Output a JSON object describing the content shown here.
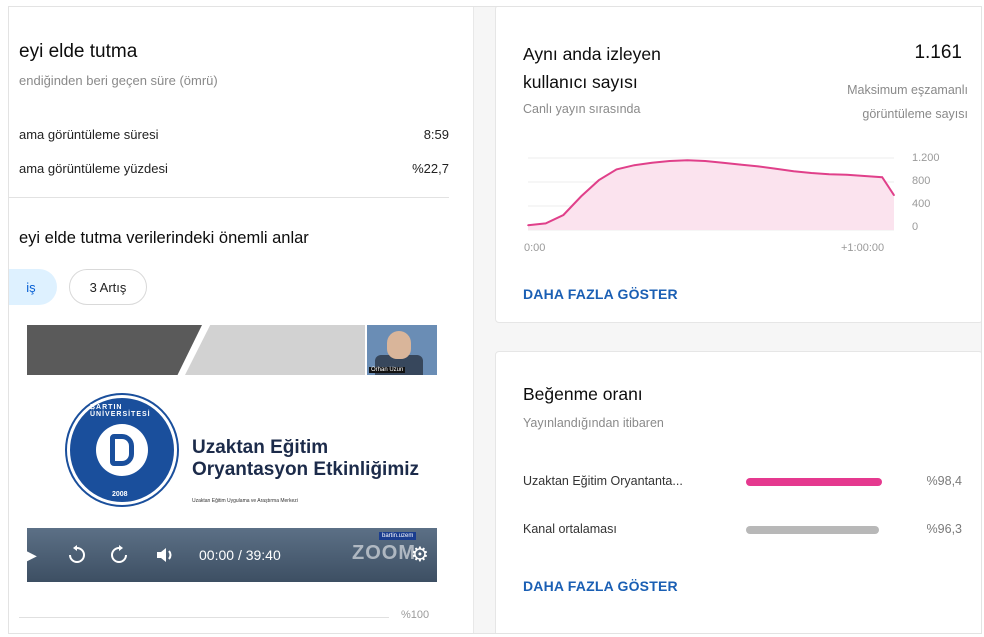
{
  "retention": {
    "title": "eyi elde tutma",
    "subtitle": "endiğinden beri geçen süre (ömrü)",
    "metrics": [
      {
        "label": "ama görüntüleme süresi",
        "value": "8:59"
      },
      {
        "label": "ama görüntüleme yüzdesi",
        "value": "%22,7"
      }
    ],
    "moments_title": "eyi elde tutma verilerindeki önemli anlar",
    "chips": [
      {
        "label": "iş",
        "active": true
      },
      {
        "label": "3 Artış",
        "active": false
      }
    ],
    "bottom_axis_label": "%100"
  },
  "video": {
    "slide_title_line1": "Uzaktan Eğitim",
    "slide_title_line2": "Oryantasyon Etkinliğimiz",
    "slide_small_text": "Uzaktan Eğitim Uygulama ve Araştırma Merkezi",
    "logo_ring_text": "BARTIN ÜNİVERSİTESİ",
    "logo_year": "2008",
    "cam_name": "Orhan Uzun",
    "time_current": "00:00",
    "time_total": "39:40",
    "watermark": "ZOOM",
    "badge_text": "bartin.uzem"
  },
  "concurrent": {
    "title_line1": "Aynı anda izleyen",
    "title_line2": "kullanıcı sayısı",
    "subtitle": "Canlı yayın sırasında",
    "value": "1.161",
    "value_sub_line1": "Maksimum eşzamanlı",
    "value_sub_line2": "görüntüleme sayısı",
    "more_label": "DAHA FAZLA GÖSTER"
  },
  "chart_data": {
    "type": "area",
    "x_tick_labels": [
      "0:00",
      "+1:00:00"
    ],
    "y_tick_labels": [
      "1.200",
      "800",
      "400",
      "0"
    ],
    "ylim": [
      0,
      1200
    ],
    "x_minutes": [
      0,
      3,
      6,
      9,
      12,
      15,
      18,
      21,
      24,
      27,
      30,
      33,
      36,
      39,
      42,
      45,
      48,
      51,
      54,
      57,
      60,
      62
    ],
    "values": [
      80,
      110,
      250,
      560,
      830,
      1010,
      1080,
      1120,
      1150,
      1161,
      1150,
      1120,
      1090,
      1060,
      1020,
      980,
      950,
      930,
      920,
      900,
      880,
      580
    ],
    "color": "#e0408a",
    "fill": "#fbe3ee",
    "grid": true
  },
  "likes": {
    "title": "Beğenme oranı",
    "subtitle": "Yayınlandığından itibaren",
    "rows": [
      {
        "label": "Uzaktan Eğitim Oryantanta...",
        "value": "%98,4",
        "fraction": 0.984,
        "color": "#e5398f"
      },
      {
        "label": "Kanal ortalaması",
        "value": "%96,3",
        "fraction": 0.963,
        "color": "#b8b8b8"
      }
    ],
    "more_label": "DAHA FAZLA GÖSTER"
  }
}
